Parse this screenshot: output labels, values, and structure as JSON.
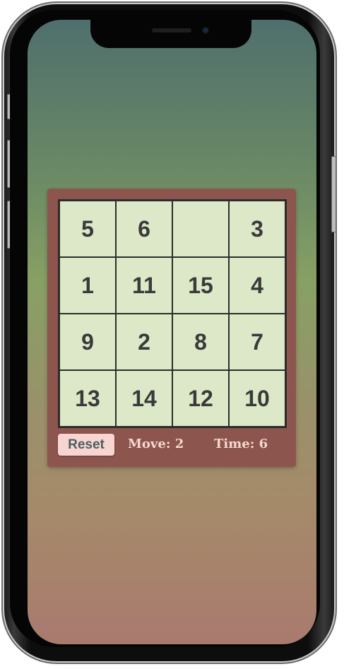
{
  "puzzle": {
    "tiles": [
      "5",
      "6",
      "",
      "3",
      "1",
      "11",
      "15",
      "4",
      "9",
      "2",
      "8",
      "7",
      "13",
      "14",
      "12",
      "10"
    ]
  },
  "controls": {
    "reset_label": "Reset",
    "moves_label": "Move:",
    "moves_value": "2",
    "time_label": "Time:",
    "time_value": "6"
  },
  "colors": {
    "panel": "#8c554d",
    "tile": "#dce8c7",
    "reset_button": "#f7d6d2",
    "stat_text": "#f5d8cf"
  }
}
